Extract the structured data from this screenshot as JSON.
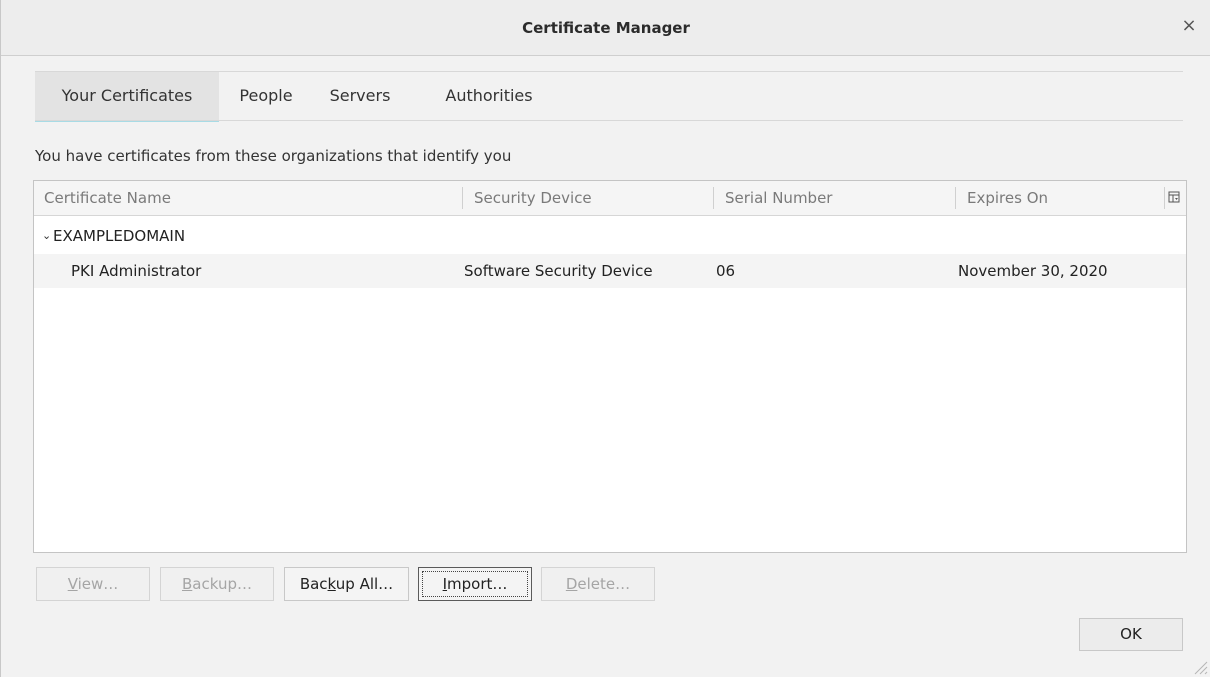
{
  "window": {
    "title": "Certificate Manager",
    "close_glyph": "×"
  },
  "tabs": [
    {
      "label": "Your Certificates",
      "active": true
    },
    {
      "label": "People",
      "active": false
    },
    {
      "label": "Servers",
      "active": false
    },
    {
      "label": "Authorities",
      "active": false
    }
  ],
  "intro_text": "You have certificates from these organizations that identify you",
  "table": {
    "columns": [
      "Certificate Name",
      "Security Device",
      "Serial Number",
      "Expires On"
    ],
    "column_picker_icon": "column-picker-icon",
    "groups": [
      {
        "name": "EXAMPLEDOMAIN",
        "expanded": true,
        "rows": [
          {
            "certificate_name": "PKI Administrator",
            "security_device": "Software Security Device",
            "serial_number": "06",
            "expires_on": "November 30, 2020"
          }
        ]
      }
    ]
  },
  "buttons": {
    "view": {
      "prefix": "",
      "accel": "V",
      "suffix": "iew…",
      "enabled": false
    },
    "backup": {
      "prefix": "",
      "accel": "B",
      "suffix": "ackup…",
      "enabled": false
    },
    "backup_all": {
      "prefix": "Bac",
      "accel": "k",
      "suffix": "up All…",
      "enabled": true
    },
    "import": {
      "prefix": "",
      "accel": "I",
      "suffix": "mport…",
      "enabled": true,
      "focused": true
    },
    "delete": {
      "prefix": "",
      "accel": "D",
      "suffix": "elete…",
      "enabled": false
    },
    "ok": "OK"
  },
  "colors": {
    "active_tab_underline": "#a8dbe5",
    "disabled_text": "#a5a5a5"
  }
}
